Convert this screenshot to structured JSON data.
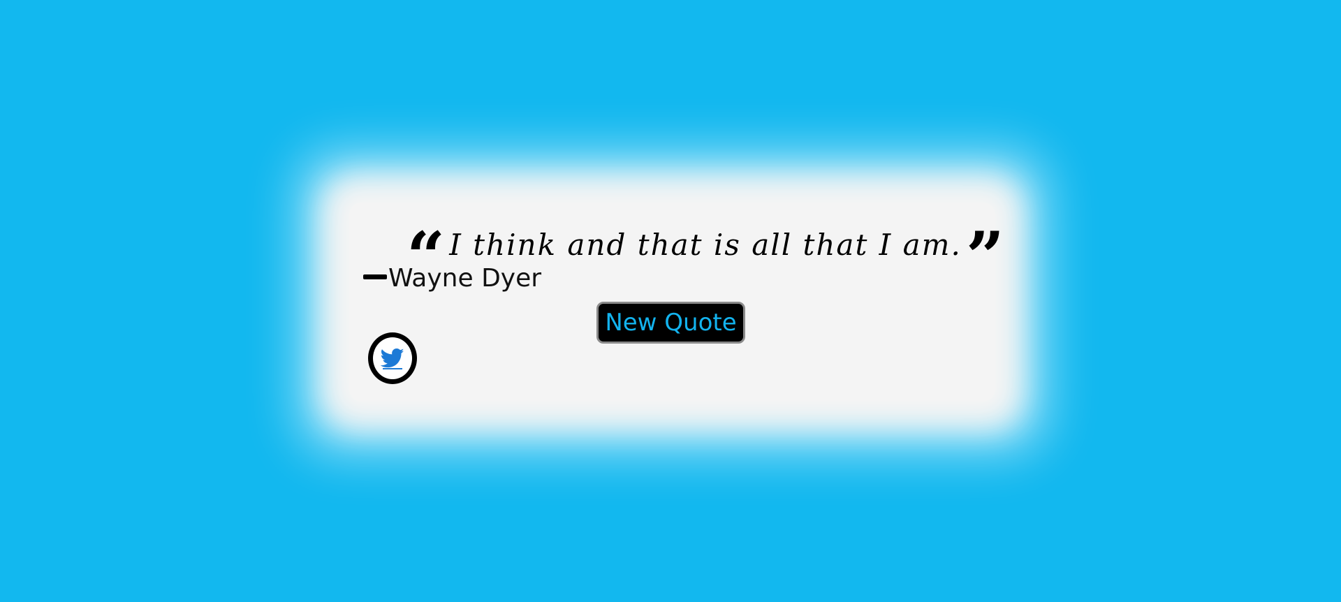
{
  "quote": {
    "open_mark": "“",
    "text": "I think and that is all that I am.",
    "close_mark": "”"
  },
  "author": {
    "name": "Wayne Dyer"
  },
  "buttons": {
    "new_quote_label": "New Quote",
    "tweet_icon": "twitter-bird-icon"
  },
  "colors": {
    "background": "#12b8ef",
    "card": "#f4f4f4",
    "accent": "#13b3ee",
    "twitter_blue": "#1d7ad6"
  }
}
